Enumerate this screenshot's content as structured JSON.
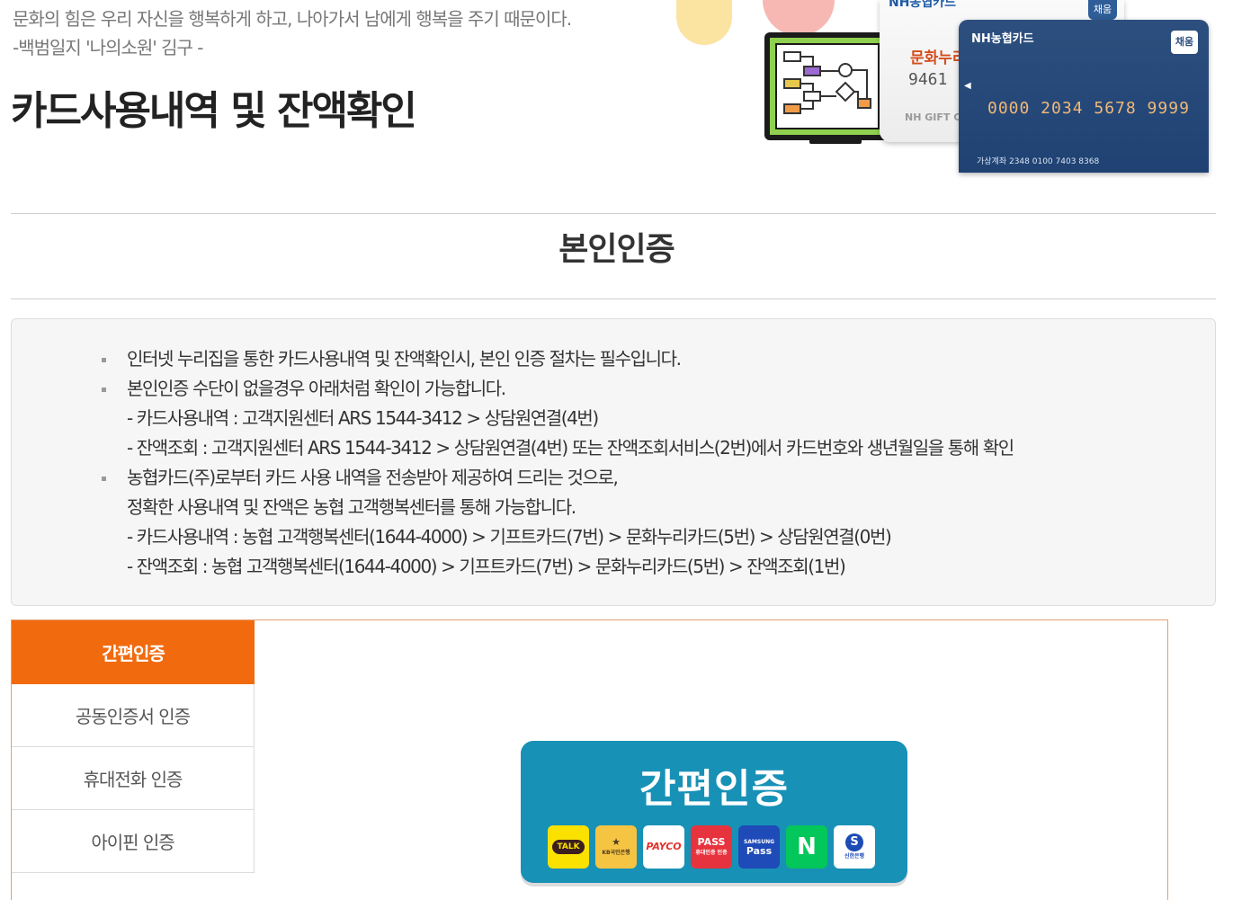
{
  "header": {
    "quote": "문화의 힘은 우리 자신을 행복하게 하고, 나아가서 남에게 행복을 주기 때문이다.",
    "quote_author": "-백범일지 '나의소원' 김구 -",
    "page_title": "카드사용내역 및 잔액확인",
    "illustration": {
      "white_card_brand": "NH농협카드",
      "white_card_badge": "채움",
      "white_card_logo": "문화누리",
      "white_card_number": "9461",
      "white_card_sub": "NH GIFT CA",
      "blue_card_brand": "NH농협카드",
      "blue_card_badge": "채움",
      "blue_card_number": "0000 2034 5678 9999",
      "blue_card_footer": "가상계좌 2348 0100 7403 8368"
    }
  },
  "section": {
    "title": "본인인증"
  },
  "notice": {
    "lines": [
      {
        "text": "인터넷 누리집을 통한 카드사용내역 및 잔액확인시, 본인 인증 절차는 필수입니다.",
        "bullet": true
      },
      {
        "text": "본인인증 수단이 없을경우 아래처럼 확인이 가능합니다.",
        "bullet": true
      },
      {
        "text": "- 카드사용내역 : 고객지원센터 ARS 1544-3412 > 상담원연결(4번)",
        "bullet": false
      },
      {
        "text": "- 잔액조회 : 고객지원센터 ARS 1544-3412 > 상담원연결(4번) 또는 잔액조회서비스(2번)에서 카드번호와 생년월일을 통해 확인",
        "bullet": false
      },
      {
        "text": "농협카드(주)로부터 카드 사용 내역을 전송받아 제공하여 드리는 것으로,",
        "bullet": true
      },
      {
        "text": "정확한 사용내역 및 잔액은 농협 고객행복센터를 통해 가능합니다.",
        "bullet": false
      },
      {
        "text": "- 카드사용내역 : 농협 고객행복센터(1644-4000) > 기프트카드(7번) > 문화누리카드(5번) > 상담원연결(0번)",
        "bullet": false
      },
      {
        "text": "- 잔액조회 : 농협 고객행복센터(1644-4000) > 기프트카드(7번) > 문화누리카드(5번) > 잔액조회(1번)",
        "bullet": false
      }
    ]
  },
  "auth": {
    "tabs": [
      {
        "label": "간편인증",
        "active": true
      },
      {
        "label": "공동인증서 인증",
        "active": false
      },
      {
        "label": "휴대전화 인증",
        "active": false
      },
      {
        "label": "아이핀 인증",
        "active": false
      }
    ],
    "easy_auth": {
      "title": "간편인증",
      "providers": {
        "kakao": "TALK",
        "kb": "KB국민은행",
        "payco": "PAYCO",
        "pass": "PASS",
        "pass_sub": "휴대인증 인증",
        "samsung_top": "SAMSUNG",
        "samsung": "Pass",
        "naver": "N",
        "shinhan": "신한은행"
      }
    }
  },
  "colors": {
    "accent": "#f26a0e",
    "easy_auth_bg": "#1891b6",
    "notice_bg": "#f6f6f6"
  }
}
